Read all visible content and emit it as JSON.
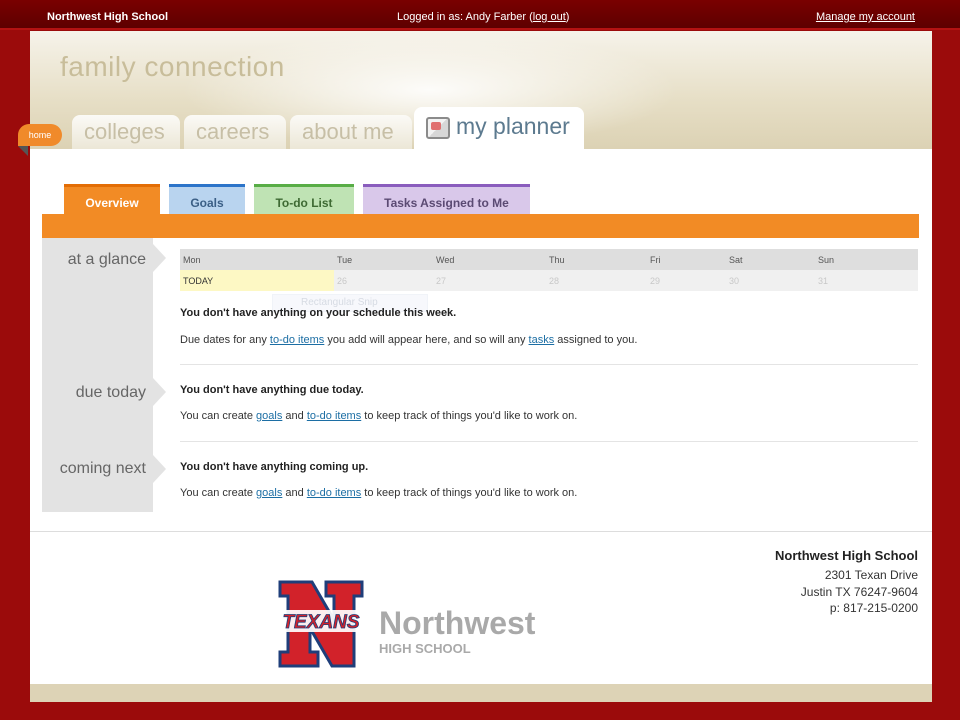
{
  "topbar": {
    "school": "Northwest High School",
    "logged_prefix": "Logged in as: Andy Farber (",
    "logout": "log out",
    "logged_suffix": ")",
    "manage": "Manage my account"
  },
  "header": {
    "brand": "family connection",
    "home": "home",
    "tabs": {
      "colleges": "colleges",
      "careers": "careers",
      "about_me": "about me",
      "my_planner": "my planner"
    }
  },
  "subtabs": {
    "overview": "Overview",
    "goals": "Goals",
    "todo": "To-do List",
    "tasks": "Tasks Assigned to Me"
  },
  "sections": {
    "at_a_glance": "at a glance",
    "due_today": "due today",
    "coming_next": "coming next"
  },
  "calendar": {
    "days": [
      "Mon",
      "Tue",
      "Wed",
      "Thu",
      "Fri",
      "Sat",
      "Sun"
    ],
    "today": "TODAY",
    "dates": [
      "26",
      "27",
      "28",
      "29",
      "30",
      "31"
    ],
    "tooltip": "Rectangular Snip"
  },
  "glance": {
    "title": "You don't have anything on your schedule this week.",
    "text_1": "Due dates for any ",
    "link_todo": "to-do items",
    "text_2": " you add will appear here, and so will any ",
    "link_tasks": "tasks",
    "text_3": " assigned to you."
  },
  "due": {
    "title": "You don't have anything due today.",
    "text_1": "You can create ",
    "link_goals": "goals",
    "text_2": " and ",
    "link_todo": "to-do items",
    "text_3": " to keep track of things you'd like to work on."
  },
  "coming": {
    "title": "You don't have anything coming up.",
    "text_1": "You can create ",
    "link_goals": "goals",
    "text_2": " and ",
    "link_todo": "to-do items",
    "text_3": " to keep track of things you'd like to work on."
  },
  "footer": {
    "name": "Northwest High School",
    "street": "2301 Texan Drive",
    "city": "Justin TX 76247-9604",
    "phone": "p: 817-215-0200",
    "logo_word": "TEXANS",
    "logo_name": "Northwest",
    "logo_sub": "HIGH SCHOOL"
  },
  "colors": {
    "brand_red": "#9b0b0b",
    "orange": "#f28b25",
    "link": "#1c6ea4"
  }
}
